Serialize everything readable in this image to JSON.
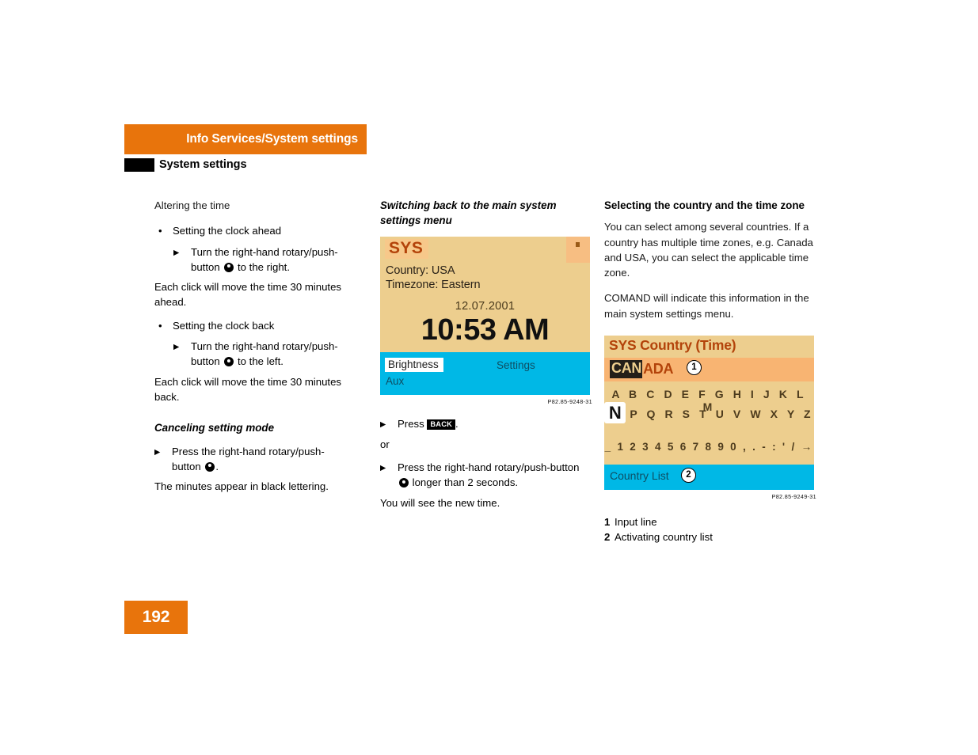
{
  "header": {
    "chapter_title": "Info Services/System settings",
    "section_title": "System settings",
    "accent_color": "#E8740C",
    "swatch_color": "#000000"
  },
  "left_column": {
    "intro": "Altering the time",
    "bullet_mark": "•",
    "arrow_mark": "▶",
    "items": [
      {
        "bullet": "Setting the clock ahead",
        "step_pre": "Turn the right-hand rotary/push-button ",
        "step_post": " to the right.",
        "note": "Each click will move the time 30 minutes ahead."
      },
      {
        "bullet": "Setting the clock back",
        "step_pre": "Turn the right-hand rotary/push-button ",
        "step_post": " to the left.",
        "note": "Each click will move the time 30 minutes back."
      }
    ],
    "cancel_heading": "Canceling setting mode",
    "cancel_step_pre": "Press the right-hand rotary/push-button ",
    "cancel_step_post": ".",
    "cancel_note": "The minutes appear in black lettering."
  },
  "middle_column": {
    "heading": "Switching back to the main system settings menu",
    "arrow_mark": "▶",
    "figure_caption": "P82.85-9248-31",
    "screen": {
      "title": "SYS",
      "country_line": "Country: USA",
      "timezone_line": "Timezone: Eastern",
      "date": "12.07.2001",
      "time": "10:53 AM",
      "brightness_label": "Brightness",
      "settings_label": "Settings",
      "aux_label": "Aux",
      "background_color": "#EDCE8E",
      "bottom_bar_color": "#00B8E6",
      "title_color": "#B3430A"
    },
    "step_1_pre": "Press ",
    "step_1_key": "BACK",
    "step_1_post": ".",
    "or_text": "or",
    "step_2_pre": "Press the right-hand rotary/push-button ",
    "step_2_post": " longer than 2 seconds.",
    "step_2_note": "You will see the new time."
  },
  "right_column": {
    "heading": "Selecting the country and the time zone",
    "paragraph_1": "You can select among several countries. If a country has multiple time zones, e.g. Canada and USA, you can select the applicable time zone.",
    "paragraph_2": "COMAND will indicate this information in the main system settings menu.",
    "figure_caption": "P82.85-9249-31",
    "screen": {
      "title": "SYS Country (Time)",
      "input_selected": "CAN",
      "input_rest": "ADA",
      "callout_1": "1",
      "alphabet_row_1": "A B C D E F G H I J K L M",
      "selected_letter": "N",
      "alphabet_row_2": "P Q R S T U V W X Y Z",
      "symbol_row": "_ 1 2 3 4 5 6 7 8 9 0 , . - : ' / →",
      "bottom_label": "Country List",
      "callout_2": "2",
      "background_color": "#EDCE8E",
      "input_band_color": "#F8B472",
      "bottom_bar_color": "#00B8E6"
    },
    "legend": [
      {
        "num": "1",
        "label": "Input line"
      },
      {
        "num": "2",
        "label": "Activating country list"
      }
    ]
  },
  "footer": {
    "page_number": "192"
  }
}
